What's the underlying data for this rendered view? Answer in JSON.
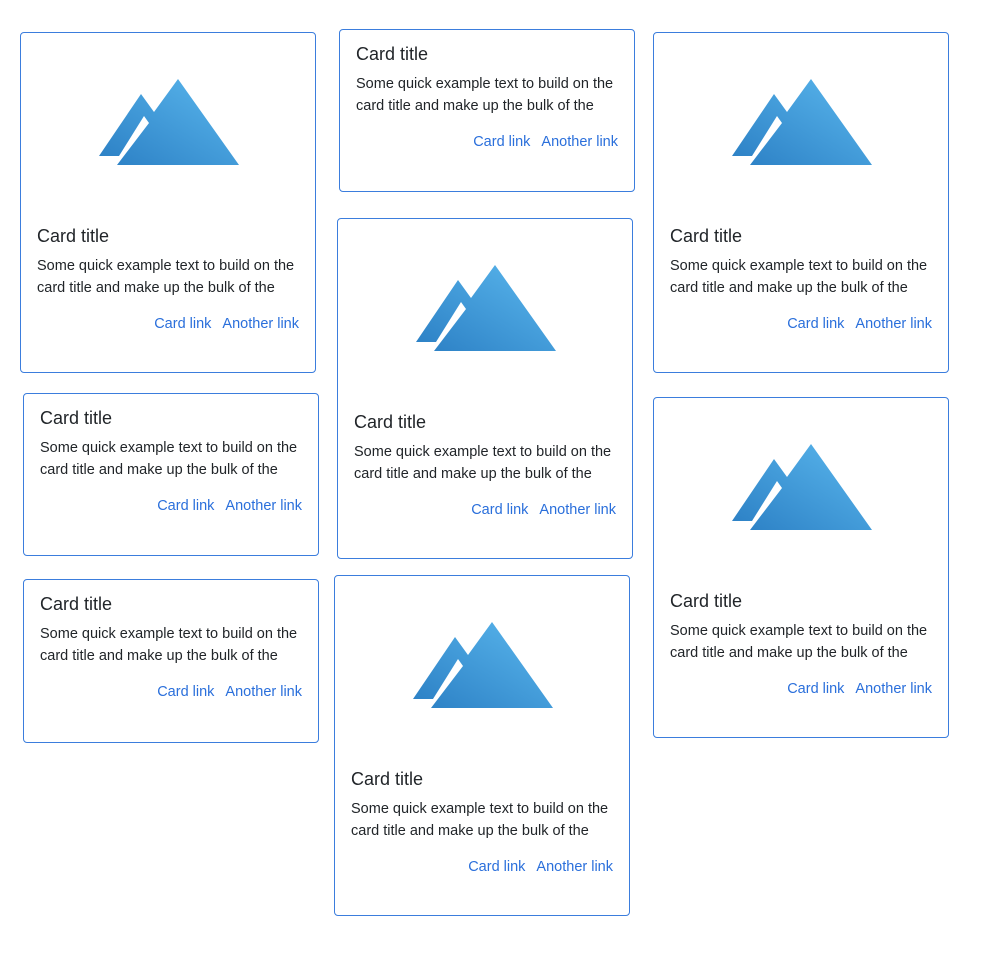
{
  "accent_color": "#2a6fdb",
  "border_color": "#3b7ddd",
  "image_icon": "mountain-icon",
  "cards": [
    {
      "title": "Card title",
      "text": "Some quick example text to build on the card title and make up the bulk of the",
      "link1": "Card link",
      "link2": "Another link",
      "has_image": true
    },
    {
      "title": "Card title",
      "text": "Some quick example text to build on the card title and make up the bulk of the",
      "link1": "Card link",
      "link2": "Another link",
      "has_image": false
    },
    {
      "title": "Card title",
      "text": "Some quick example text to build on the card title and make up the bulk of the",
      "link1": "Card link",
      "link2": "Another link",
      "has_image": false
    },
    {
      "title": "Card title",
      "text": "Some quick example text to build on the card title and make up the bulk of the",
      "link1": "Card link",
      "link2": "Another link",
      "has_image": false
    },
    {
      "title": "Card title",
      "text": "Some quick example text to build on the card title and make up the bulk of the",
      "link1": "Card link",
      "link2": "Another link",
      "has_image": true
    },
    {
      "title": "Card title",
      "text": "Some quick example text to build on the card title and make up the bulk of the",
      "link1": "Card link",
      "link2": "Another link",
      "has_image": true
    },
    {
      "title": "Card title",
      "text": "Some quick example text to build on the card title and make up the bulk of the",
      "link1": "Card link",
      "link2": "Another link",
      "has_image": true
    },
    {
      "title": "Card title",
      "text": "Some quick example text to build on the card title and make up the bulk of the",
      "link1": "Card link",
      "link2": "Another link",
      "has_image": true
    }
  ]
}
